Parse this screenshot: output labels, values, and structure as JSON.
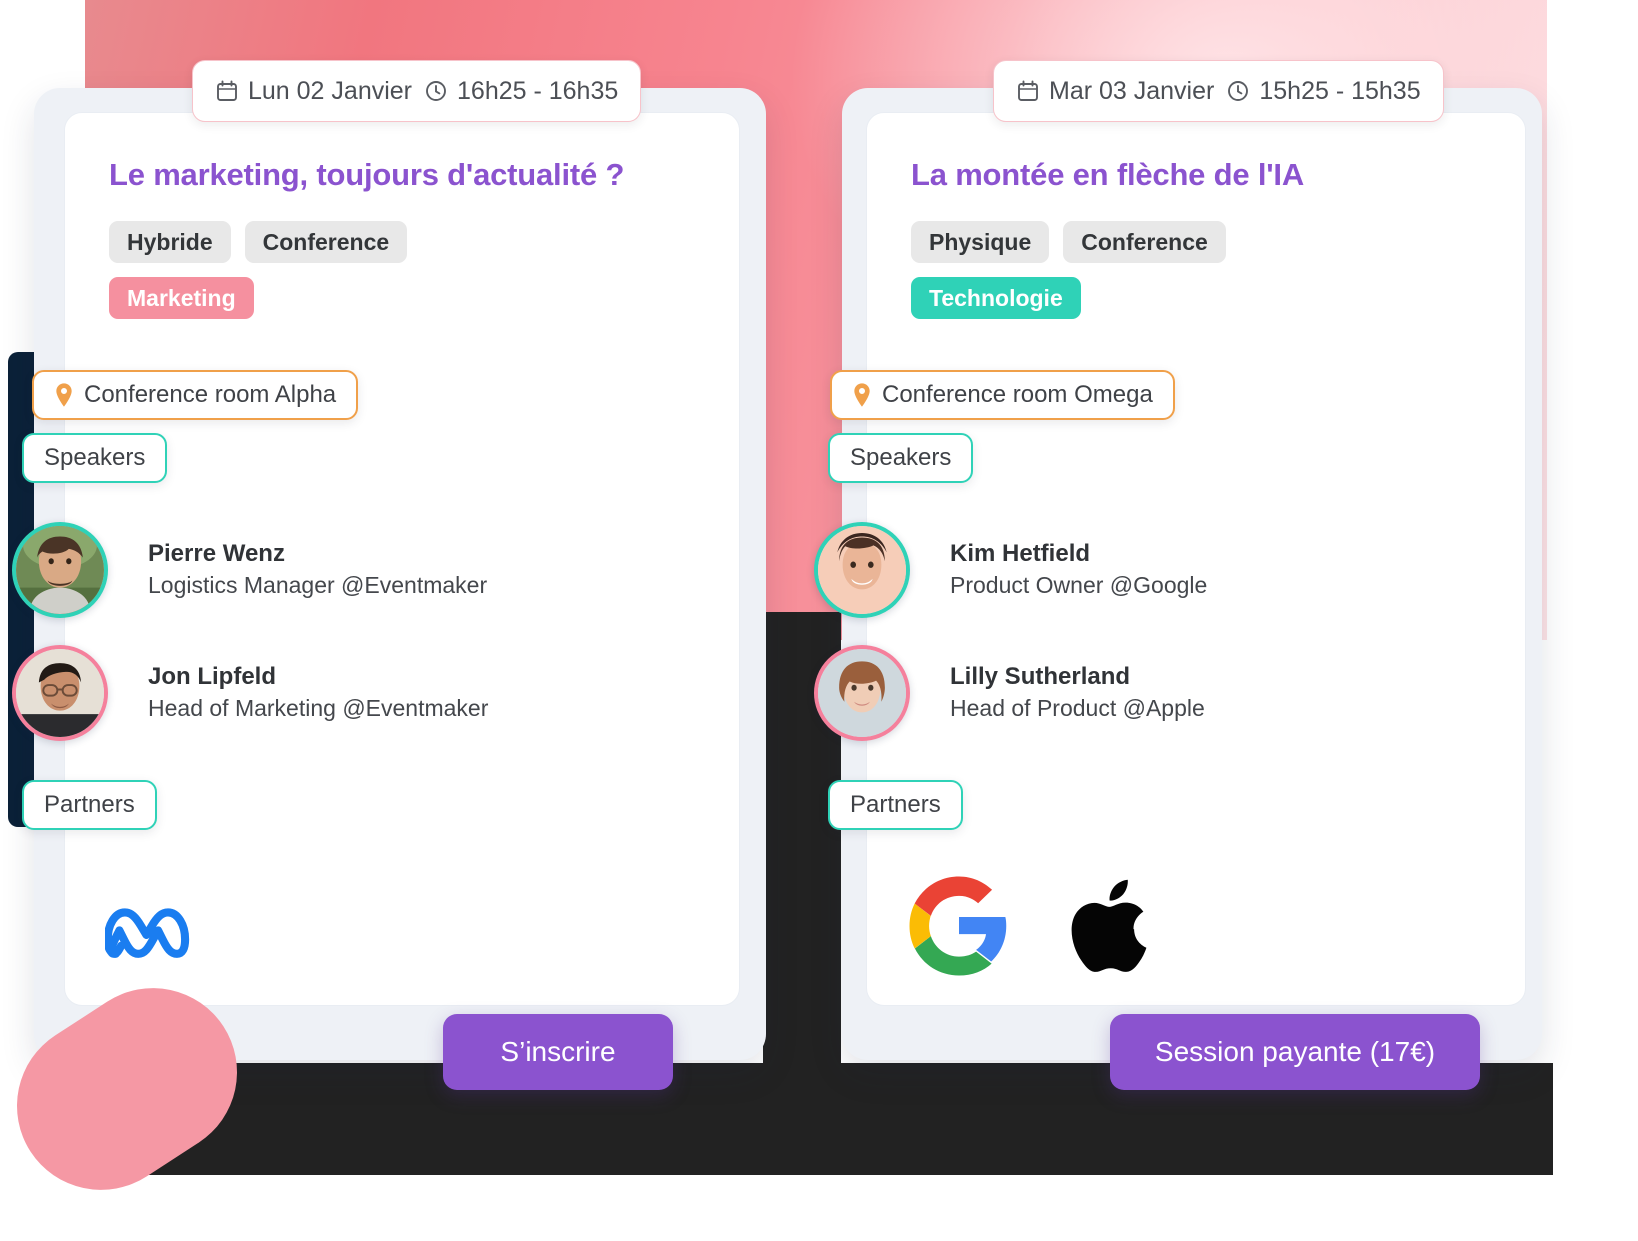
{
  "theme": {
    "accent_purple": "#8b53cf",
    "accent_teal": "#2fd2b7",
    "accent_pink": "#f5909f",
    "accent_orange": "#f0a04a",
    "dark": "#222222",
    "navy": "#0b2138",
    "frame_grey": "#eef1f6"
  },
  "cards": [
    {
      "date_badge": {
        "calendar_icon": "calendar-icon",
        "date": "Lun 02 Janvier",
        "clock_icon": "clock-icon",
        "time": "16h25 - 16h35"
      },
      "title": "Le marketing, toujours d'actualité ?",
      "tags": [
        {
          "label": "Hybride",
          "style": "grey"
        },
        {
          "label": "Conference",
          "style": "grey"
        },
        {
          "label": "Marketing",
          "style": "pink"
        }
      ],
      "location": {
        "icon": "map-pin-icon",
        "label": "Conference room Alpha"
      },
      "speakers_label": "Speakers",
      "speakers": [
        {
          "name": "Pierre Wenz",
          "role": "Logistics Manager @Eventmaker",
          "ring": "teal"
        },
        {
          "name": "Jon Lipfeld",
          "role": "Head of Marketing @Eventmaker",
          "ring": "pink"
        }
      ],
      "partners_label": "Partners",
      "partners": [
        {
          "name": "meta-logo"
        }
      ],
      "cta": "S’inscrire"
    },
    {
      "date_badge": {
        "calendar_icon": "calendar-icon",
        "date": "Mar 03 Janvier",
        "clock_icon": "clock-icon",
        "time": "15h25 - 15h35"
      },
      "title": "La montée en flèche de l'IA",
      "tags": [
        {
          "label": "Physique",
          "style": "grey"
        },
        {
          "label": "Conference",
          "style": "grey"
        },
        {
          "label": "Technologie",
          "style": "teal"
        }
      ],
      "location": {
        "icon": "map-pin-icon",
        "label": "Conference room Omega"
      },
      "speakers_label": "Speakers",
      "speakers": [
        {
          "name": "Kim Hetfield",
          "role": "Product Owner @Google",
          "ring": "teal"
        },
        {
          "name": "Lilly Sutherland",
          "role": "Head of Product @Apple",
          "ring": "pink"
        }
      ],
      "partners_label": "Partners",
      "partners": [
        {
          "name": "google-logo"
        },
        {
          "name": "apple-logo"
        }
      ],
      "cta": "Session payante (17€)"
    }
  ]
}
